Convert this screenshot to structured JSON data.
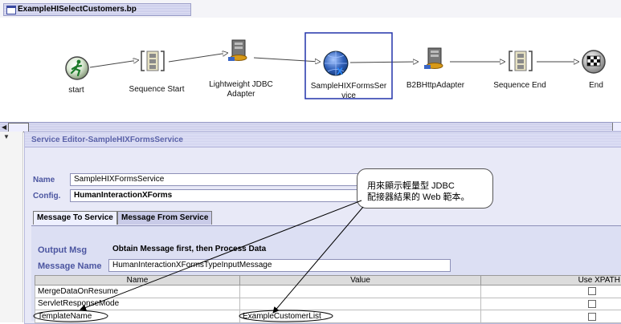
{
  "window": {
    "title": "ExampleHISelectCustomers.bp"
  },
  "process": {
    "nodes": [
      {
        "id": "start",
        "label": "start",
        "icon": "running-man-icon"
      },
      {
        "id": "seq-start",
        "label": "Sequence Start",
        "icon": "sequence-icon"
      },
      {
        "id": "jdbc",
        "label_line1": "Lightweight JDBC",
        "label_line2": "Adapter",
        "icon": "server-icon"
      },
      {
        "id": "forms",
        "label_line1": "SampleHIXFormsSer",
        "label_line2": "vice",
        "icon": "globe-x-icon",
        "selected": true
      },
      {
        "id": "b2b",
        "label": "B2BHttpAdapter",
        "icon": "server-icon"
      },
      {
        "id": "seq-end",
        "label": "Sequence End",
        "icon": "sequence-icon"
      },
      {
        "id": "end",
        "label": "End",
        "icon": "checkered-flag-icon"
      }
    ]
  },
  "editor": {
    "title": "Service Editor-SampleHIXFormsService",
    "name_label": "Name",
    "name_value": "SampleHIXFormsService",
    "config_label": "Config.",
    "config_value": "HumanInteractionXForms",
    "tabs": [
      {
        "label": "Message To Service",
        "active": true
      },
      {
        "label": "Message From Service",
        "active": false
      }
    ],
    "output_msg_label": "Output Msg",
    "output_msg_value": "Obtain Message first, then Process Data",
    "message_name_label": "Message Name",
    "message_name_value": "HumanInteractionXFormsTypeInputMessage",
    "table": {
      "columns": [
        "Name",
        "Value",
        "Use XPATH"
      ],
      "rows": [
        {
          "name": "MergeDataOnResume",
          "value": "",
          "xpath": false
        },
        {
          "name": "ServletResponseMode",
          "value": "",
          "xpath": false
        },
        {
          "name": "TemplateName",
          "value": "ExampleCustomerList",
          "xpath": false
        }
      ]
    }
  },
  "callout": {
    "line1": "用來顯示輕量型 JDBC",
    "line2": "配接器結果的 Web 範本。"
  },
  "colors": {
    "selection": "#2233aa",
    "editor_label": "#4b55a0",
    "panel_bg": "#e8e9f7"
  }
}
